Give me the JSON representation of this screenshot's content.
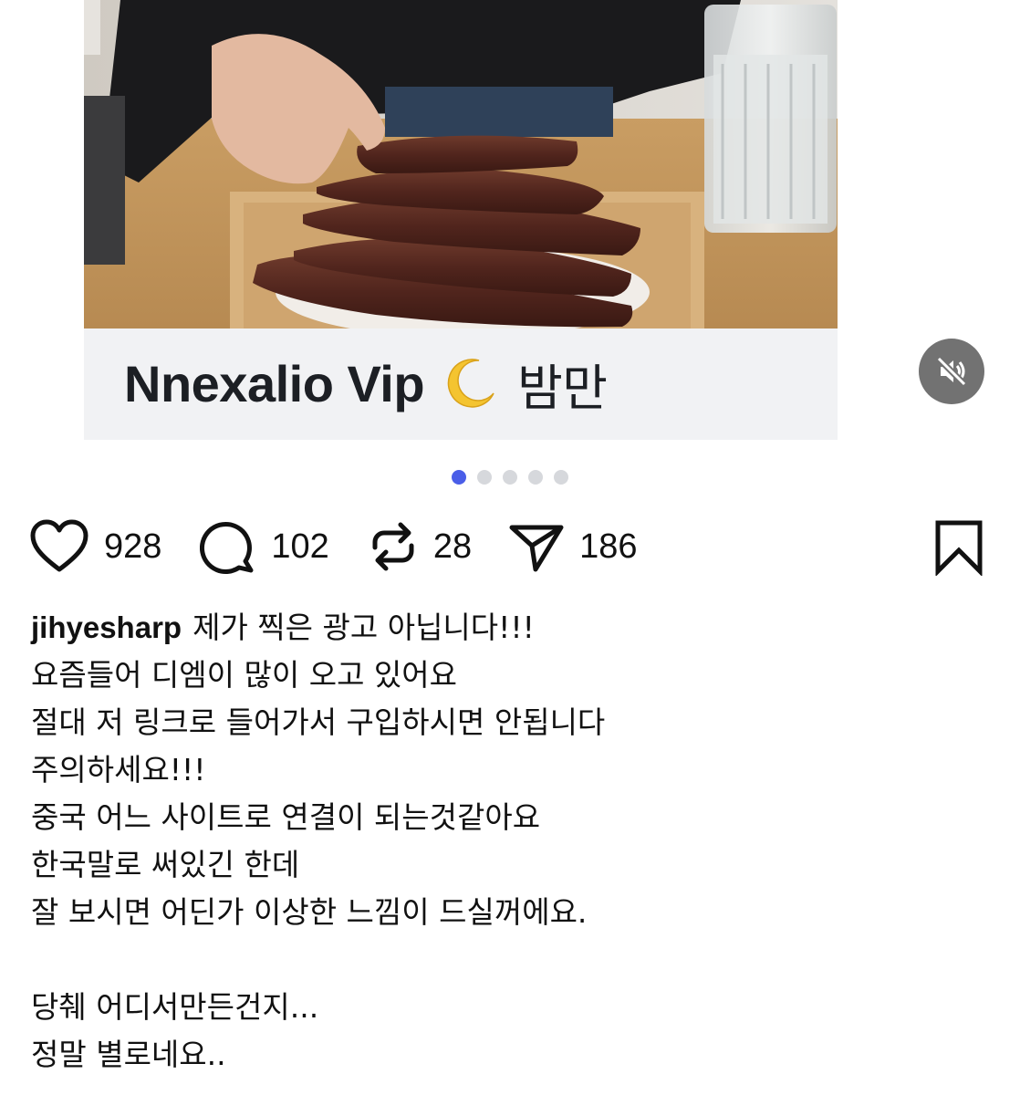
{
  "media": {
    "caption_latin": "Nnexalio Vip",
    "caption_korean": "밤만",
    "moon_icon": "crescent-moon-icon",
    "dots_total": 5,
    "dots_active_index": 0,
    "dot_active_color": "#4a5ee8",
    "dot_inactive_color": "#d6d8dc"
  },
  "controls": {
    "mute_icon": "speaker-muted-icon"
  },
  "actions": {
    "likes": "928",
    "comments": "102",
    "reposts": "28",
    "shares": "186",
    "like_icon": "heart-icon",
    "comment_icon": "speech-bubble-icon",
    "repost_icon": "repost-arrows-icon",
    "share_icon": "paper-plane-icon",
    "bookmark_icon": "bookmark-icon"
  },
  "post": {
    "username": "jihyesharp",
    "first_line": "제가 찍은 광고 아닙니다!!!",
    "lines": [
      "요즘들어 디엠이 많이 오고 있어요",
      "절대 저 링크로 들어가서 구입하시면 안됩니다",
      "주의하세요!!!",
      "중국 어느 사이트로 연결이 되는것같아요",
      "한국말로 써있긴 한데",
      "잘 보시면 어딘가 이상한 느낌이 드실꺼에요.",
      "",
      "당췌 어디서만든건지...",
      "정말 별로네요.."
    ]
  }
}
